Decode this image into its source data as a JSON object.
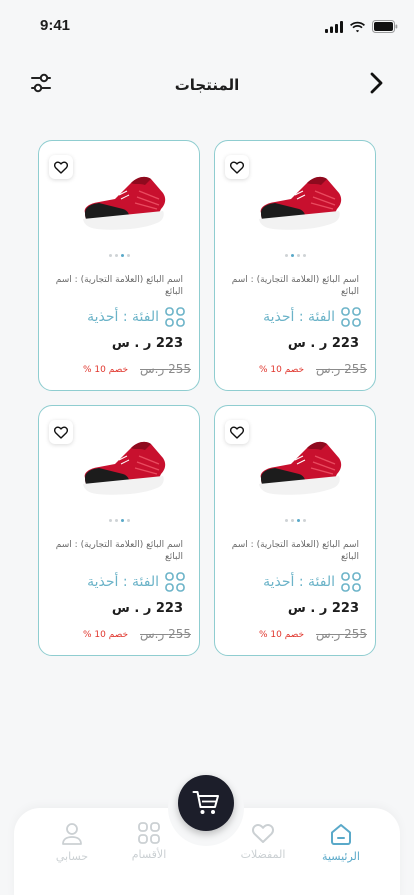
{
  "status_bar": {
    "time": "9:41"
  },
  "header": {
    "title": "المنتجات"
  },
  "products": [
    {
      "vendor": "اسم البائع (العلامة التجارية) : اسم البائع",
      "category": "الفئة : أحذية",
      "price": "223 ر . س",
      "old_price": "255 ر.س",
      "discount": "خصم 10 %"
    },
    {
      "vendor": "اسم البائع (العلامة التجارية) : اسم البائع",
      "category": "الفئة : أحذية",
      "price": "223 ر . س",
      "old_price": "255 ر.س",
      "discount": "خصم 10 %"
    },
    {
      "vendor": "اسم البائع (العلامة التجارية) : اسم البائع",
      "category": "الفئة : أحذية",
      "price": "223 ر . س",
      "old_price": "255 ر.س",
      "discount": "خصم 10 %"
    },
    {
      "vendor": "اسم البائع (العلامة التجارية) : اسم البائع",
      "category": "الفئة : أحذية",
      "price": "223 ر . س",
      "old_price": "255 ر.س",
      "discount": "خصم 10 %"
    }
  ],
  "bottom_nav": {
    "items": [
      {
        "label": "الرئيسية",
        "icon": "home-icon",
        "active": true
      },
      {
        "label": "المفضلات",
        "icon": "heart-icon",
        "active": false
      },
      {
        "label": "الأقسام",
        "icon": "grid-icon",
        "active": false
      },
      {
        "label": "حسابي",
        "icon": "user-icon",
        "active": false
      }
    ],
    "cart_icon": "cart-icon"
  },
  "colors": {
    "accent": "#5aa9c9",
    "card_border": "#8fcdd0",
    "discount": "#e0352c",
    "cart_button": "#1c1e2a"
  }
}
